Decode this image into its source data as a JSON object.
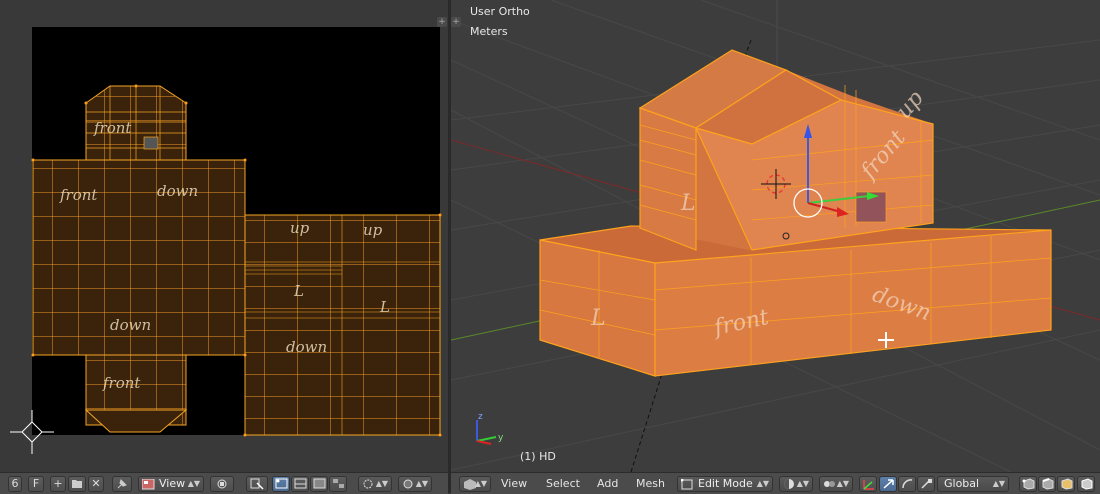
{
  "viewport": {
    "view_name": "User Ortho",
    "units": "Meters",
    "object_label": "(1) HD",
    "axis_labels": {
      "z": "z",
      "y": "y"
    },
    "face_texts": [
      "front",
      "front",
      "up",
      "down",
      "L",
      "L"
    ]
  },
  "uv_editor": {
    "handwriting": [
      "front",
      "down",
      "front",
      "down",
      "front",
      "up",
      "L",
      "L",
      "up",
      "down"
    ],
    "header": {
      "layer_num": "6",
      "f_label": "F",
      "view_menu": "View"
    }
  },
  "view3d_header": {
    "menus": [
      "View",
      "Select",
      "Add",
      "Mesh"
    ],
    "mode": "Edit Mode",
    "orientation": "Global"
  },
  "colors": {
    "mesh_face": "#d8743e",
    "mesh_edge": "#ffa21c",
    "uv_face": "#3a220b",
    "background": "#3d3d3d"
  }
}
